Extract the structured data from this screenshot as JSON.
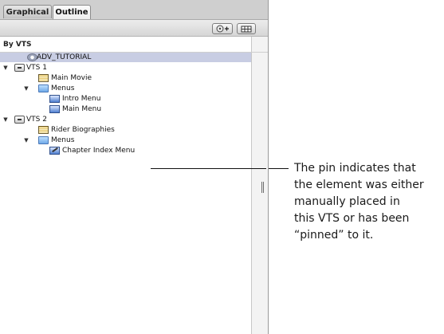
{
  "tabs": [
    {
      "label": "Graphical",
      "active": false
    },
    {
      "label": "Outline",
      "active": true
    }
  ],
  "toolbar": {
    "add_vts_icon": "disc-plus-icon",
    "view_icon": "grid-view-icon"
  },
  "outline": {
    "section_title": "By VTS",
    "rows": [
      {
        "label": "ADV_TUTORIAL",
        "icon": "disc-icon",
        "selected": true
      },
      {
        "label": "VTS 1",
        "icon": "vts-icon",
        "expanded": true
      },
      {
        "label": "Main Movie",
        "icon": "movie-track-icon"
      },
      {
        "label": "Menus",
        "icon": "folder-icon",
        "expanded": true
      },
      {
        "label": "Intro Menu",
        "icon": "menu-icon"
      },
      {
        "label": "Main Menu",
        "icon": "menu-icon"
      },
      {
        "label": "VTS 2",
        "icon": "vts-icon",
        "expanded": true
      },
      {
        "label": "Rider Biographies",
        "icon": "movie-track-icon"
      },
      {
        "label": "Menus",
        "icon": "folder-icon",
        "expanded": true
      },
      {
        "label": "Chapter Index Menu",
        "icon": "pinned-menu-icon"
      }
    ]
  },
  "callout": {
    "lines": [
      "The pin indicates that",
      "the element was either",
      "manually placed in",
      "this VTS or has been",
      "“pinned” to it."
    ]
  },
  "colors": {
    "panel_bg": "#d9d9d9",
    "selection": "#c8cde3",
    "list_bg": "#ffffff"
  }
}
